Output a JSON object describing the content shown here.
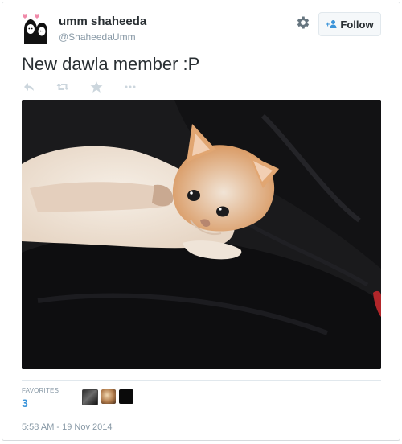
{
  "user": {
    "name": "umm shaheeda",
    "handle": "@ShaheedaUmm"
  },
  "header": {
    "follow_label": "Follow",
    "follow_icon": "add-person-icon",
    "settings_icon": "gear-icon"
  },
  "tweet": {
    "text": "New dawla member :P",
    "actions": [
      "reply-icon",
      "retweet-icon",
      "favorite-icon",
      "more-icon"
    ],
    "media_description": "kitten"
  },
  "stats": {
    "favorites_label": "FAVORITES",
    "favorites_count": "3"
  },
  "timestamp": "5:58 AM - 19 Nov 2014",
  "colors": {
    "accent": "#3b94d9",
    "text": "#292f33",
    "muted": "#8899a6",
    "border": "#e1e8ed"
  }
}
